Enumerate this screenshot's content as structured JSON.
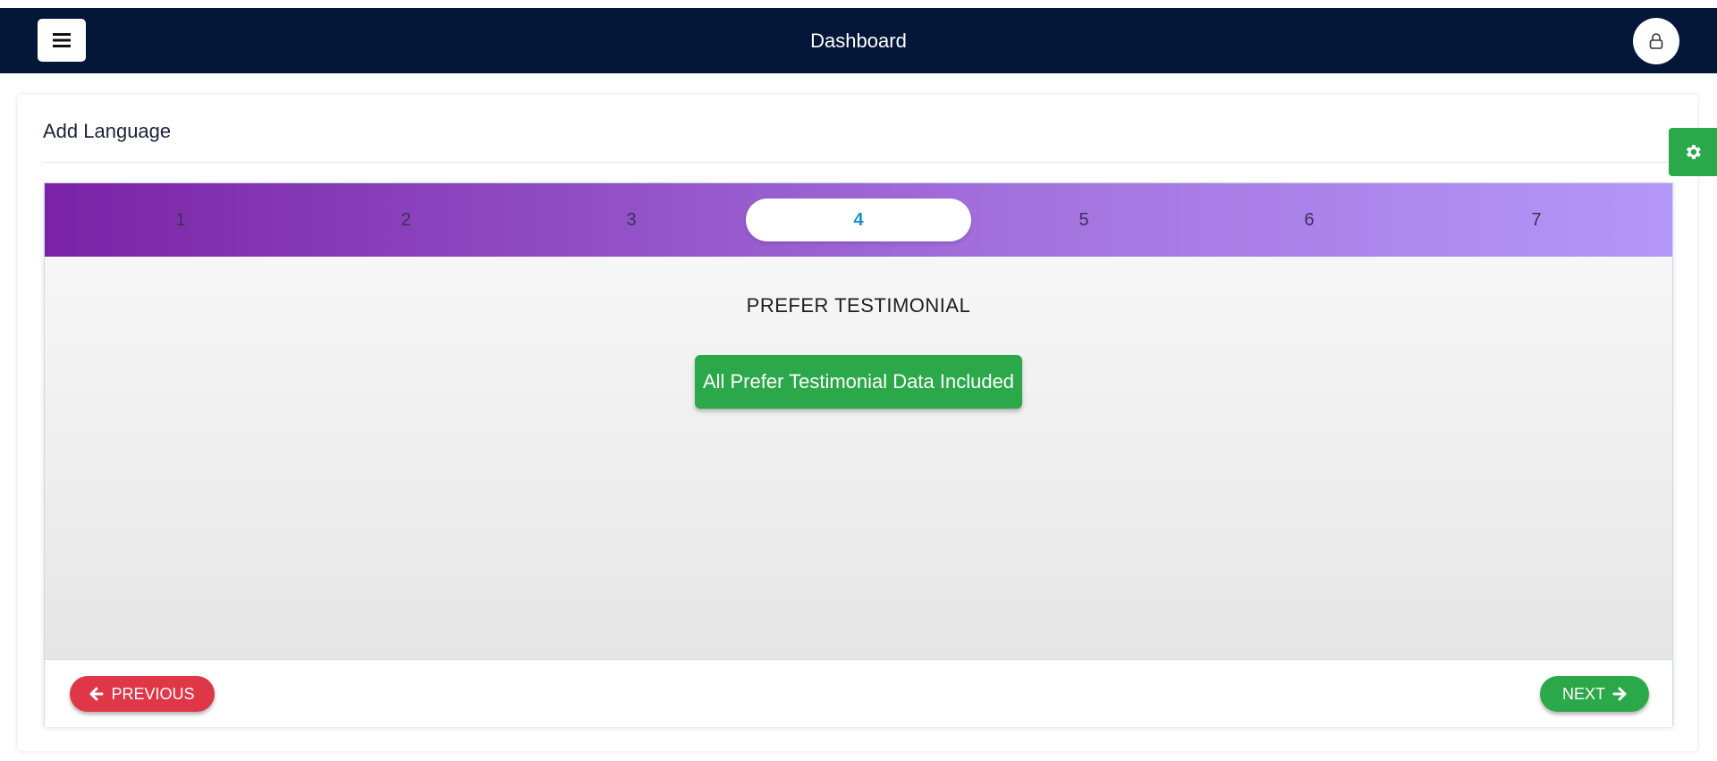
{
  "header": {
    "title": "Dashboard",
    "menu_icon": "hamburger-menu-icon",
    "profile_icon": "user-lock-icon",
    "background_color": "#051738"
  },
  "card": {
    "title": "Add Language"
  },
  "settings": {
    "icon": "gear-icon",
    "color": "#2ba84a"
  },
  "wizard": {
    "steps": [
      {
        "label": "1"
      },
      {
        "label": "2"
      },
      {
        "label": "3"
      },
      {
        "label": "4"
      },
      {
        "label": "5"
      },
      {
        "label": "6"
      },
      {
        "label": "7"
      }
    ],
    "active_step": "4",
    "section_title": "PREFER TESTIMONIAL",
    "included_label": "All Prefer Testimonial Data Included",
    "previous_label": "PREVIOUS",
    "next_label": "NEXT",
    "previous_color": "#e03748",
    "next_color": "#2ba84a",
    "active_step_color": "#1a8fcf"
  }
}
